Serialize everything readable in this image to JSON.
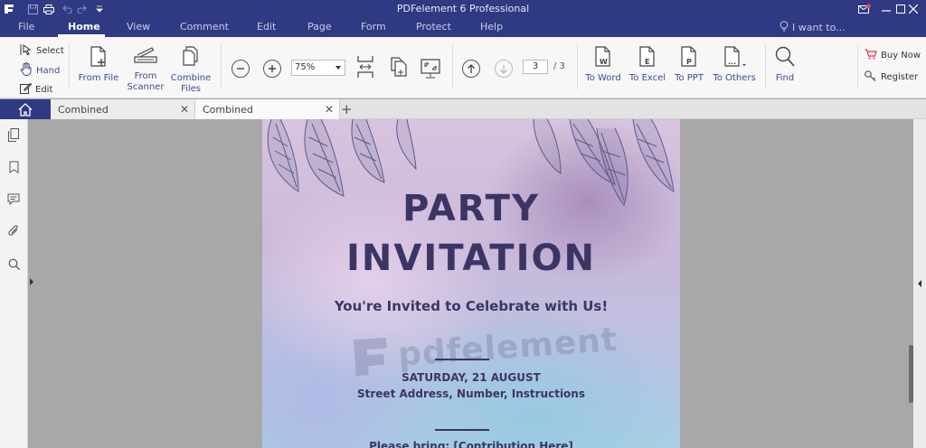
{
  "window": {
    "title": "PDFelement 6 Professional"
  },
  "menu": {
    "items": [
      "File",
      "Home",
      "View",
      "Comment",
      "Edit",
      "Page",
      "Form",
      "Protect",
      "Help"
    ],
    "active": "Home",
    "search_placeholder": "I want to..."
  },
  "ribbon": {
    "modes": {
      "select": "Select",
      "hand": "Hand",
      "edit": "Edit"
    },
    "from_file": "From File",
    "from_scanner_1": "From",
    "from_scanner_2": "Scanner",
    "combine_1": "Combine",
    "combine_2": "Files",
    "zoom": "75%",
    "page_current": "3",
    "page_total": "/ 3",
    "to_word": "To Word",
    "to_excel": "To Excel",
    "to_ppt": "To PPT",
    "to_others": "To Others",
    "find": "Find",
    "buy_now": "Buy Now",
    "register": "Register"
  },
  "tabs": [
    {
      "label": "Combined"
    },
    {
      "label": "Combined"
    }
  ],
  "document": {
    "title_line1": "PARTY",
    "title_line2": "INVITATION",
    "subtitle": "You're Invited to Celebrate with Us!",
    "date": "SATURDAY, 21 AUGUST",
    "address": "Street Address, Number, Instructions",
    "bring": "Please bring: [Contribution Here]",
    "watermark": "pdfelement"
  },
  "colors": {
    "brand": "#2f3a83",
    "accent_link": "#3d4b8f",
    "doc_text": "#3b3566",
    "buy_cart": "#d9343a"
  }
}
